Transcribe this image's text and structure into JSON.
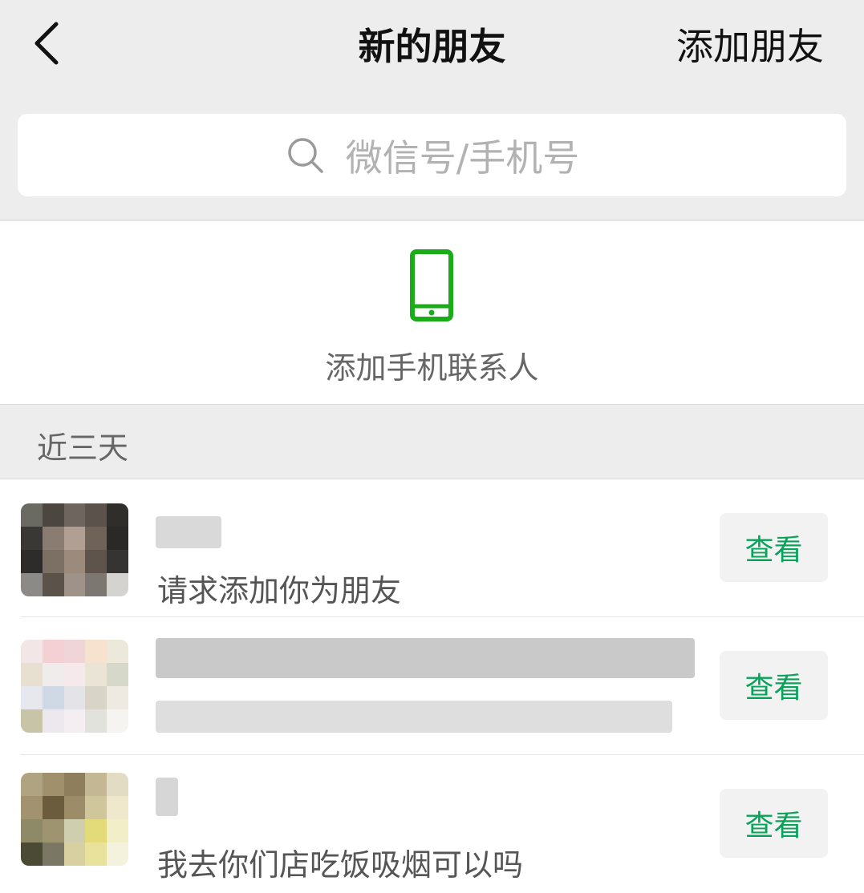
{
  "nav": {
    "back_icon": "chevron-left-icon",
    "title": "新的朋友",
    "action_label": "添加朋友"
  },
  "search": {
    "icon": "search-icon",
    "placeholder": "微信号/手机号"
  },
  "add_contacts": {
    "icon": "mobile-phone-icon",
    "label": "添加手机联系人",
    "icon_color": "#1aad19"
  },
  "section": {
    "title": "近三天"
  },
  "requests": [
    {
      "message": "请求添加你为朋友",
      "button_label": "查看"
    },
    {
      "message": "",
      "button_label": "查看"
    },
    {
      "message": "我去你们店吃饭吸烟可以吗",
      "button_label": "查看"
    }
  ],
  "colors": {
    "background": "#ededed",
    "accent": "#07a35a",
    "button_bg": "#f2f2f2"
  }
}
